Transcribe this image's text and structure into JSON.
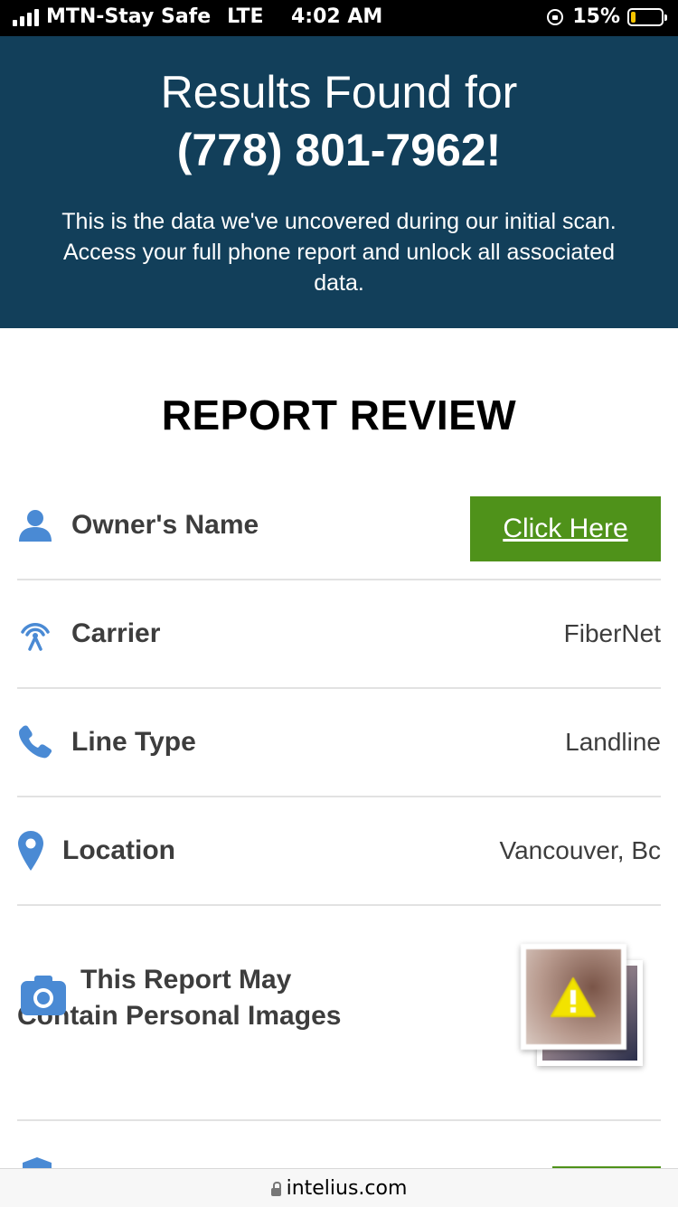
{
  "status_bar": {
    "carrier": "MTN-Stay Safe",
    "network": "LTE",
    "time": "4:02 AM",
    "battery": "15%"
  },
  "hero": {
    "title_line1": "Results Found for",
    "phone": "(778) 801-7962!",
    "description": "This is the data we've uncovered during our initial scan. Access your full phone report and unlock all associated data."
  },
  "report": {
    "title": "REPORT REVIEW",
    "rows": [
      {
        "label": "Owner's Name",
        "action": "Click Here",
        "icon": "person-icon"
      },
      {
        "label": "Carrier",
        "value": "FiberNet",
        "icon": "signal-tower-icon"
      },
      {
        "label": "Line Type",
        "value": "Landline",
        "icon": "phone-icon"
      },
      {
        "label": "Location",
        "value": "Vancouver, Bc",
        "icon": "map-pin-icon"
      },
      {
        "label": "This Report May Contain Personal Images",
        "icon": "camera-icon"
      }
    ]
  },
  "browser": {
    "url": "intelius.com"
  },
  "colors": {
    "hero_bg": "#123f5a",
    "cta_green": "#4f921a",
    "icon_blue": "#4a8ad4"
  }
}
